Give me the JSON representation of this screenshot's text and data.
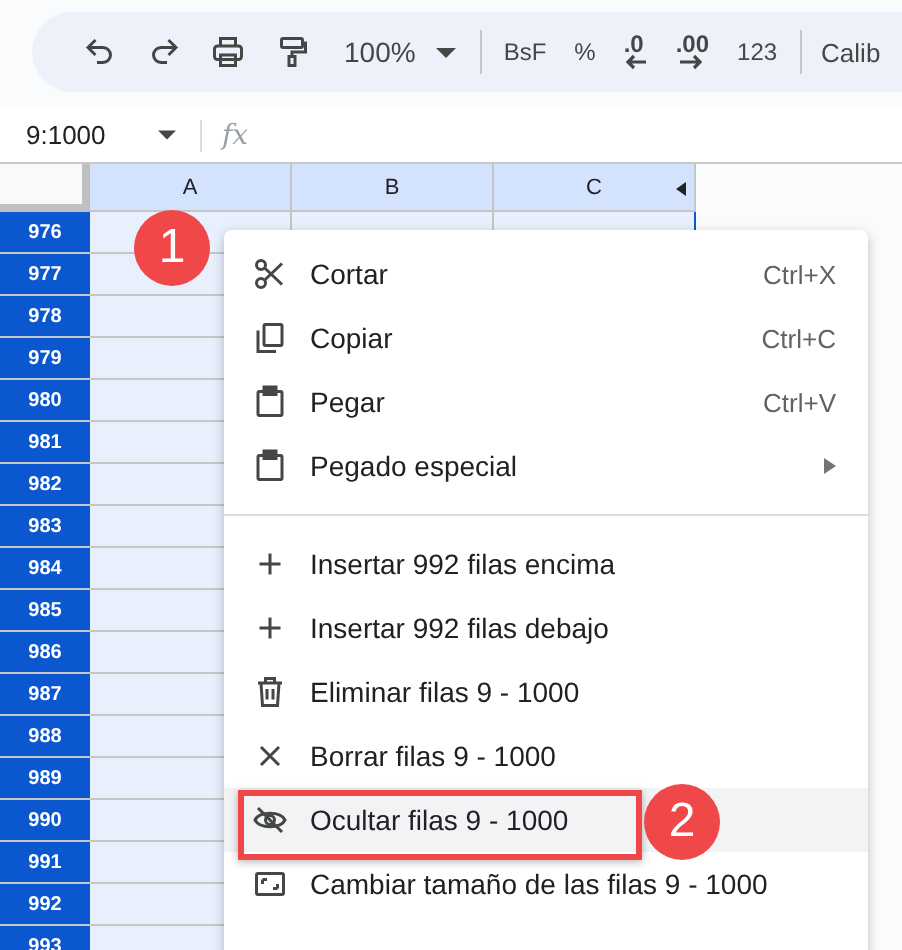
{
  "toolbar": {
    "zoom": "100%",
    "items": [
      {
        "kind": "text",
        "label": "BsF"
      },
      {
        "kind": "text",
        "label": "%"
      },
      {
        "kind": "decrease",
        "label": ".0"
      },
      {
        "kind": "increase",
        "label": ".00"
      },
      {
        "kind": "text",
        "label": "123"
      }
    ],
    "font": "Calib"
  },
  "formula_bar": {
    "name_box": "9:1000",
    "fx": "fx"
  },
  "columns": [
    {
      "label": "A",
      "selected": false
    },
    {
      "label": "B",
      "selected": false
    },
    {
      "label": "C",
      "selected": false
    }
  ],
  "rows": [
    {
      "label": "976",
      "selected": true
    },
    {
      "label": "977",
      "selected": true
    },
    {
      "label": "978",
      "selected": true
    },
    {
      "label": "979",
      "selected": true
    },
    {
      "label": "980",
      "selected": true
    },
    {
      "label": "981",
      "selected": true
    },
    {
      "label": "982",
      "selected": true
    },
    {
      "label": "983",
      "selected": true
    },
    {
      "label": "984",
      "selected": true
    },
    {
      "label": "985",
      "selected": true
    },
    {
      "label": "986",
      "selected": true
    },
    {
      "label": "987",
      "selected": true
    },
    {
      "label": "988",
      "selected": true
    },
    {
      "label": "989",
      "selected": true
    },
    {
      "label": "990",
      "selected": true
    },
    {
      "label": "991",
      "selected": true
    },
    {
      "label": "992",
      "selected": true
    },
    {
      "label": "993",
      "selected": true
    }
  ],
  "context_menu": {
    "groups": [
      [
        {
          "label": "Cortar",
          "shortcut": "Ctrl+X",
          "submenu": false,
          "selected": false
        },
        {
          "label": "Copiar",
          "shortcut": "Ctrl+C",
          "submenu": false,
          "selected": false
        },
        {
          "label": "Pegar",
          "shortcut": "Ctrl+V",
          "submenu": false,
          "selected": false
        },
        {
          "label": "Pegado especial",
          "submenu": true,
          "selected": false
        }
      ],
      [
        {
          "label": "Insertar 992 filas encima",
          "submenu": false,
          "selected": false
        },
        {
          "label": "Insertar 992 filas debajo",
          "submenu": false,
          "selected": false
        },
        {
          "label": "Eliminar filas 9 - 1000",
          "submenu": false,
          "selected": false
        },
        {
          "label": "Borrar filas 9 - 1000",
          "submenu": false,
          "selected": false
        },
        {
          "label": "Ocultar filas 9 - 1000",
          "submenu": false,
          "selected": true
        },
        {
          "label": "Cambiar tamaño de las filas 9 - 1000",
          "submenu": false,
          "selected": false
        }
      ]
    ]
  },
  "callouts": [
    {
      "label": "1"
    },
    {
      "label": "2"
    }
  ]
}
